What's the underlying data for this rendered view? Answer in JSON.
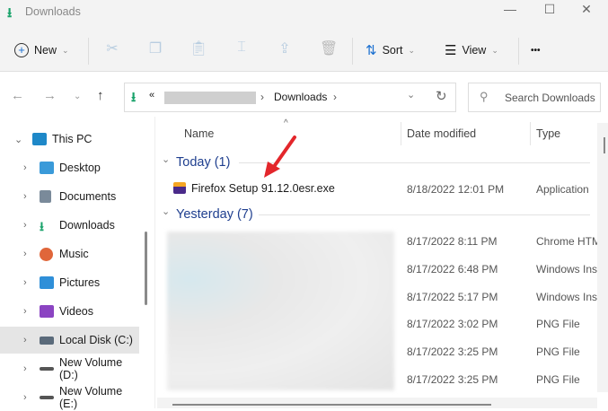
{
  "window": {
    "title": "Downloads",
    "minimize": "—",
    "maximize": "☐",
    "close": "✕"
  },
  "toolbar": {
    "new_label": "New",
    "sort_label": "Sort",
    "view_label": "View",
    "more": "•••"
  },
  "address": {
    "prefix": "«",
    "current": "Downloads",
    "sep": "›"
  },
  "search": {
    "placeholder": "Search Downloads"
  },
  "sidebar": {
    "items": [
      {
        "label": "This PC",
        "color": "#1e88c8"
      },
      {
        "label": "Desktop",
        "color": "#3a9ad9"
      },
      {
        "label": "Documents",
        "color": "#7a8a9a"
      },
      {
        "label": "Downloads",
        "color": "#1aa36b"
      },
      {
        "label": "Music",
        "color": "#e0663a"
      },
      {
        "label": "Pictures",
        "color": "#2f8fd8"
      },
      {
        "label": "Videos",
        "color": "#8b44c2"
      },
      {
        "label": "Local Disk (C:)",
        "color": "#5a6a7a"
      },
      {
        "label": "New Volume (D:)",
        "color": "#555"
      },
      {
        "label": "New Volume (E:)",
        "color": "#555"
      }
    ]
  },
  "columns": {
    "name": "Name",
    "date": "Date modified",
    "type": "Type"
  },
  "groups": [
    {
      "label": "Today (1)",
      "files": [
        {
          "name": "Firefox Setup 91.12.0esr.exe",
          "date": "8/18/2022 12:01 PM",
          "type": "Application"
        }
      ]
    },
    {
      "label": "Yesterday (7)",
      "files": [
        {
          "date": "8/17/2022 8:11 PM",
          "type": "Chrome HTM"
        },
        {
          "date": "8/17/2022 6:48 PM",
          "type": "Windows Ins"
        },
        {
          "date": "8/17/2022 5:17 PM",
          "type": "Windows Ins"
        },
        {
          "date": "8/17/2022 3:02 PM",
          "type": "PNG File"
        },
        {
          "date": "8/17/2022 3:25 PM",
          "type": "PNG File"
        },
        {
          "date": "8/17/2022 3:25 PM",
          "type": "PNG File"
        }
      ]
    }
  ]
}
